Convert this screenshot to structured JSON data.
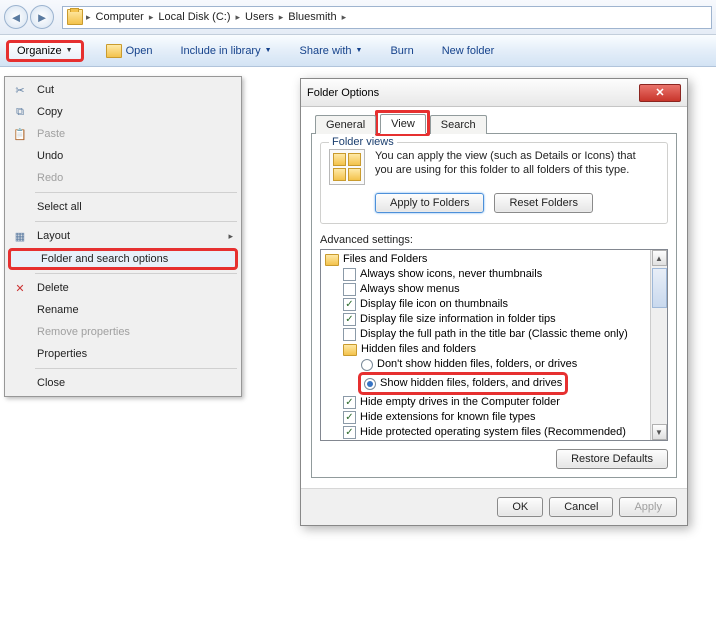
{
  "breadcrumb": [
    "Computer",
    "Local Disk (C:)",
    "Users",
    "Bluesmith"
  ],
  "toolbar": {
    "organize": "Organize",
    "open": "Open",
    "include": "Include in library",
    "share": "Share with",
    "burn": "Burn",
    "newfolder": "New folder"
  },
  "menu": {
    "cut": "Cut",
    "copy": "Copy",
    "paste": "Paste",
    "undo": "Undo",
    "redo": "Redo",
    "selectall": "Select all",
    "layout": "Layout",
    "folderopts": "Folder and search options",
    "delete": "Delete",
    "rename": "Rename",
    "removeprops": "Remove properties",
    "properties": "Properties",
    "close": "Close"
  },
  "dialog": {
    "title": "Folder Options",
    "tabs": {
      "general": "General",
      "view": "View",
      "search": "Search"
    },
    "folderviews": {
      "legend": "Folder views",
      "text1": "You can apply the view (such as Details or Icons) that",
      "text2": "you are using for this folder to all folders of this type.",
      "apply": "Apply to Folders",
      "reset": "Reset Folders"
    },
    "advlabel": "Advanced settings:",
    "tree": {
      "root": "Files and Folders",
      "i1": "Always show icons, never thumbnails",
      "i2": "Always show menus",
      "i3": "Display file icon on thumbnails",
      "i4": "Display file size information in folder tips",
      "i5": "Display the full path in the title bar (Classic theme only)",
      "hidden": "Hidden files and folders",
      "r1": "Don't show hidden files, folders, or drives",
      "r2": "Show hidden files, folders, and drives",
      "i6": "Hide empty drives in the Computer folder",
      "i7": "Hide extensions for known file types",
      "i8": "Hide protected operating system files (Recommended)"
    },
    "restore": "Restore Defaults",
    "ok": "OK",
    "cancel": "Cancel",
    "applybtn": "Apply"
  }
}
